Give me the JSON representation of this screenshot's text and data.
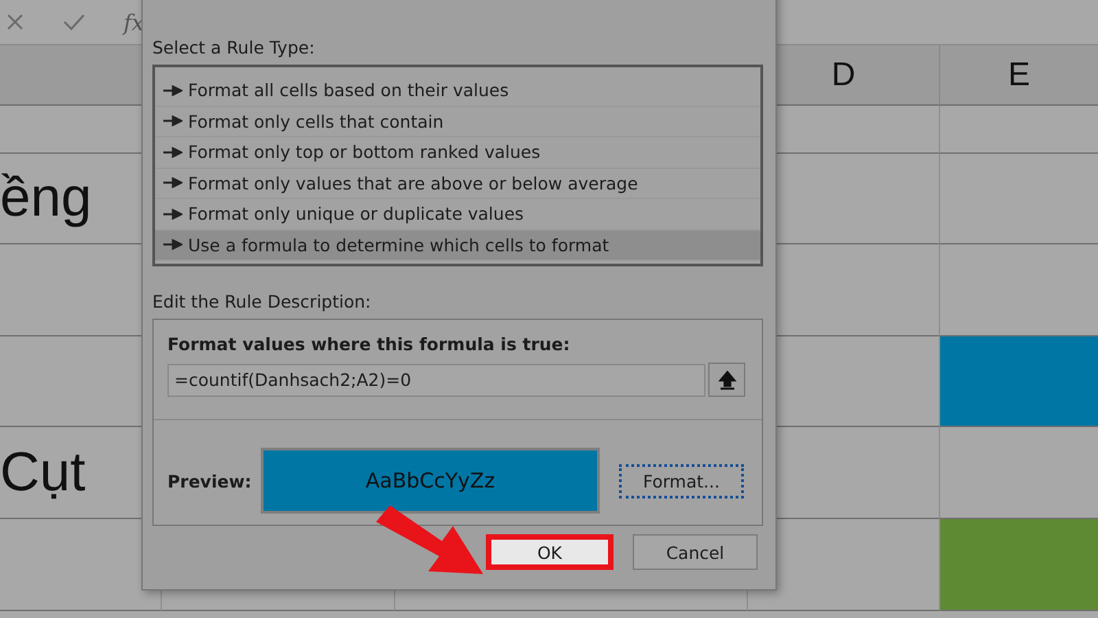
{
  "formula_bar": {
    "function_label": "fx"
  },
  "sheet": {
    "column_headers": [
      {
        "label": "D"
      },
      {
        "label": "E"
      }
    ],
    "rows": [
      {},
      {
        "text": "ềng"
      },
      {},
      {
        "color": "#0076a5"
      },
      {
        "text": "Cụt"
      },
      {
        "color": "#5f8a34"
      }
    ]
  },
  "dialog": {
    "rule_type_label": "Select a Rule Type:",
    "rule_types": [
      {
        "label": "Format all cells based on their values",
        "selected": false
      },
      {
        "label": "Format only cells that contain",
        "selected": false
      },
      {
        "label": "Format only top or bottom ranked values",
        "selected": false
      },
      {
        "label": "Format only values that are above or below average",
        "selected": false
      },
      {
        "label": "Format only unique or duplicate values",
        "selected": false
      },
      {
        "label": "Use a formula to determine which cells to format",
        "selected": true
      }
    ],
    "description_label": "Edit the Rule Description:",
    "formula_label": "Format values where this formula is true:",
    "formula": {
      "value": "=countif(Danhsach2;A2)=0"
    },
    "preview_label": "Preview:",
    "preview_sample": "AaBbCcYyZz",
    "format_button": {
      "label": "Format..."
    },
    "buttons": [
      {
        "label": "OK",
        "highlighted": true
      },
      {
        "label": "Cancel",
        "highlighted": false
      }
    ]
  }
}
